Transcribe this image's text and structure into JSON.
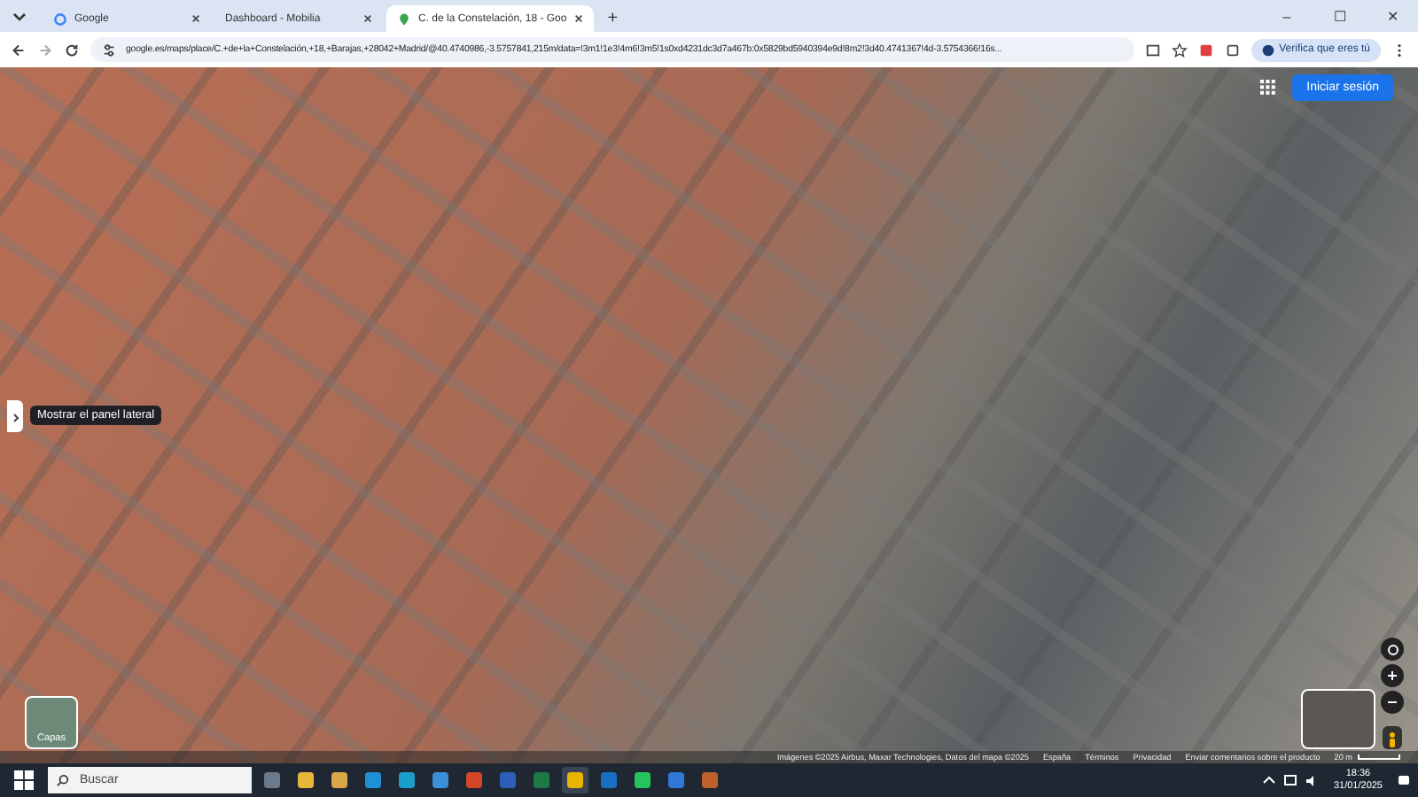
{
  "browser": {
    "tabs": [
      {
        "title": "Google",
        "kind": "google",
        "selected": false
      },
      {
        "title": "Dashboard - Mobilia",
        "kind": "blank",
        "selected": false
      },
      {
        "title": "C. de la Constelación, 18 - Goo",
        "kind": "maps",
        "selected": true
      }
    ],
    "new_tab": "+",
    "window_controls": [
      "–",
      "☐",
      "✕"
    ],
    "url": "google.es/maps/place/C.+de+la+Constelación,+18,+Barajas,+28042+Madrid/@40.4740986,-3.5757841,215m/data=!3m1!1e3!4m6!3m5!1s0xd4231dc3d7a467b:0x5829bd5940394e9d!8m2!3d40.4741367!4d-3.5754366!16s...",
    "profile_button": "Verifica que eres tú"
  },
  "map": {
    "sign_in": "Iniciar sesión",
    "side_panel_tooltip": "Mostrar el panel lateral",
    "layers": "Capas",
    "attribution": [
      {
        "text": "Imágenes ©2025 Airbus, Maxar Technologies, Datos del mapa ©2025"
      },
      {
        "text": "España"
      },
      {
        "text": "Términos"
      },
      {
        "text": "Privacidad"
      },
      {
        "text": "Enviar comentarios sobre el producto"
      }
    ],
    "scale": "20 m"
  },
  "taskbar": {
    "search_placeholder": "Buscar",
    "apps": [
      {
        "color": "#6b7a8c",
        "selected": false
      },
      {
        "color": "#e8b73a",
        "selected": false
      },
      {
        "color": "#d9a64a",
        "selected": false
      },
      {
        "color": "#1f8fd6",
        "selected": false
      },
      {
        "color": "#1aa0c8",
        "selected": false
      },
      {
        "color": "#3a8fd8",
        "selected": false
      },
      {
        "color": "#d24726",
        "selected": false
      },
      {
        "color": "#2b5fb8",
        "selected": false
      },
      {
        "color": "#1e7a45",
        "selected": false
      },
      {
        "color": "#e8b400",
        "selected": true
      },
      {
        "color": "#1a6fc0",
        "selected": false
      },
      {
        "color": "#25c45f",
        "selected": false
      },
      {
        "color": "#2f78d6",
        "selected": false
      },
      {
        "color": "#c0602a",
        "selected": false
      }
    ],
    "time": "18:36",
    "date": "31/01/2025"
  }
}
